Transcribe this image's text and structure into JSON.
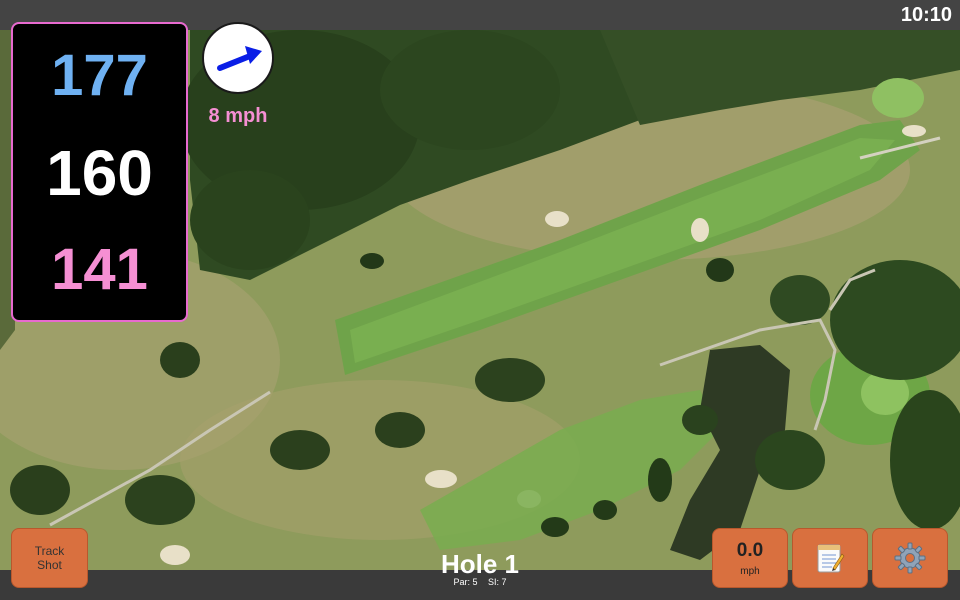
{
  "status_bar": {
    "time": "10:10"
  },
  "distances": {
    "back": "177",
    "middle": "160",
    "front": "141",
    "colors": {
      "back": "#6fb1f2",
      "middle": "#ffffff",
      "front": "#f58fd3",
      "panel_border": "#e86ad0"
    }
  },
  "wind": {
    "speed": "8 mph",
    "direction_icon": "wind-arrow-icon",
    "speed_color": "#f58fd3",
    "arrow_color": "#0a1ee6"
  },
  "buttons": {
    "track_shot": {
      "line1": "Track",
      "line2": "Shot"
    },
    "wind_adjust": {
      "value": "0.0",
      "unit": "mph"
    },
    "notes": {
      "icon": "notepad-icon"
    },
    "settings": {
      "icon": "gear-icon"
    },
    "accent_color": "#d9703f"
  },
  "hole": {
    "title": "Hole 1",
    "par": "Par: 5",
    "stroke_index": "SI: 7"
  },
  "map": {
    "type": "aerial-golf-hole"
  }
}
